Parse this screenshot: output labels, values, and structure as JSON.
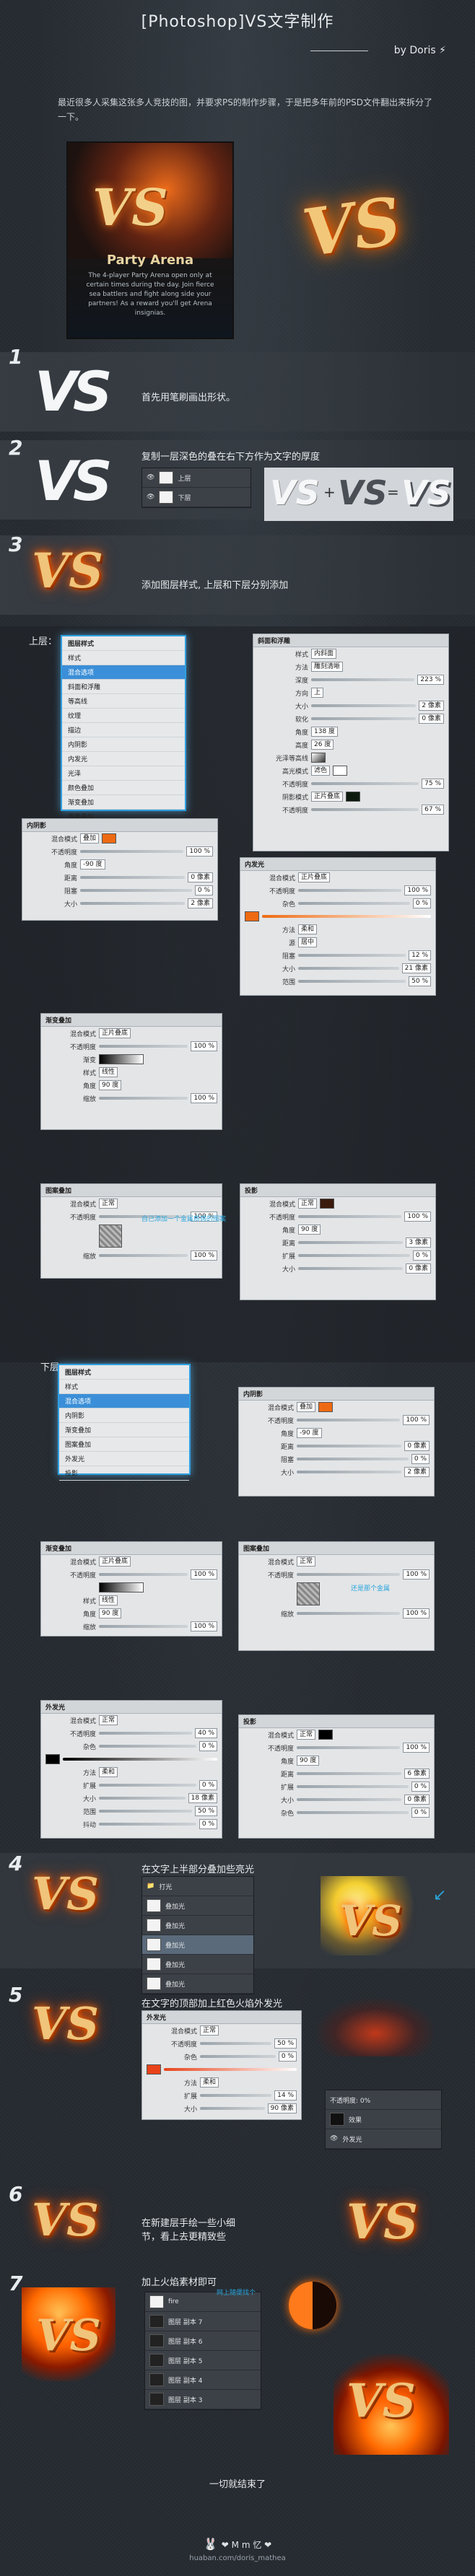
{
  "header": {
    "title": "[Photoshop]VS文字制作",
    "byline": "by Doris"
  },
  "intro": "最近很多人采集这张多人竞技的图，并要求PS的制作步骤，于是把多年前的PSD文件翻出来拆分了一下。",
  "hero": {
    "vs": "VS",
    "game_title": "Party Arena",
    "game_desc": "The 4-player Party Arena open only at certain times during the day. Join fierce sea battlers and fight along side your partners! As a reward you'll get Arena insignias."
  },
  "steps": [
    {
      "num": "1",
      "caption": "首先用笔刷画出形状。"
    },
    {
      "num": "2",
      "caption": "复制一层深色的叠在右下方作为文字的厚度",
      "layer_top": "上层",
      "layer_bottom": "下层",
      "eq": [
        "VS",
        "+",
        "VS",
        "=",
        "VS"
      ]
    },
    {
      "num": "3",
      "caption": "添加图层样式, 上层和下层分别添加"
    },
    {
      "num": "4",
      "caption": "在文字上半部分叠加些亮光"
    },
    {
      "num": "5",
      "caption": "在文字的顶部加上红色火焰外发光"
    },
    {
      "num": "6",
      "caption": "在新建层手绘一些小细节，看上去更精致些"
    },
    {
      "num": "7",
      "caption": "加上火焰素材即可",
      "note": "网上随便找个"
    }
  ],
  "upper_label": "上层：",
  "lower_label": "下层：",
  "layer_styles_upper": {
    "title": "图层样式",
    "items": [
      "样式",
      "混合选项",
      "斜面和浮雕",
      "等高线",
      "纹理",
      "描边",
      "内阴影",
      "内发光",
      "光泽",
      "颜色叠加",
      "渐变叠加",
      "图案叠加",
      "外发光",
      "投影"
    ]
  },
  "layer_styles_lower": {
    "title": "图层样式",
    "items": [
      "样式",
      "混合选项",
      "内阴影",
      "渐变叠加",
      "图案叠加",
      "外发光",
      "投影"
    ]
  },
  "bevel": {
    "title": "斜面和浮雕",
    "rows": [
      [
        "样式",
        "内斜面"
      ],
      [
        "方法",
        "雕刻清晰"
      ],
      [
        "深度",
        "223 %"
      ],
      [
        "方向",
        "上"
      ],
      [
        "大小",
        "2 像素"
      ],
      [
        "软化",
        "0 像素"
      ],
      [
        "角度",
        "138 度"
      ],
      [
        "高度",
        "26 度"
      ],
      [
        "光泽等高线",
        ""
      ],
      [
        "高光模式",
        "滤色"
      ],
      [
        "不透明度",
        "75 %"
      ],
      [
        "阴影模式",
        "正片叠底"
      ],
      [
        "不透明度",
        "67 %"
      ]
    ]
  },
  "inner_shadow": {
    "title": "内阴影",
    "rows": [
      [
        "混合模式",
        "叠加"
      ],
      [
        "不透明度",
        "100 %"
      ],
      [
        "角度",
        "-90 度"
      ],
      [
        "距离",
        "0 像素"
      ],
      [
        "阻塞",
        "0 %"
      ],
      [
        "大小",
        "2 像素"
      ]
    ],
    "color": "#ee6a12"
  },
  "inner_glow": {
    "title": "内发光",
    "rows": [
      [
        "混合模式",
        "正片叠底"
      ],
      [
        "不透明度",
        "100 %"
      ],
      [
        "杂色",
        "0 %"
      ],
      [
        "方法",
        "柔和"
      ],
      [
        "源",
        "居中"
      ],
      [
        "阻塞",
        "12 %"
      ],
      [
        "大小",
        "21 像素"
      ],
      [
        "范围",
        "50 %"
      ]
    ]
  },
  "gradient_overlay": {
    "title": "渐变叠加",
    "rows": [
      [
        "混合模式",
        "正片叠底"
      ],
      [
        "不透明度",
        "100 %"
      ],
      [
        "渐变",
        ""
      ],
      [
        "样式",
        "线性"
      ],
      [
        "角度",
        "90 度"
      ],
      [
        "缩放",
        "100 %"
      ]
    ]
  },
  "pattern_overlay": {
    "title": "图案叠加",
    "rows": [
      [
        "混合模式",
        "正常"
      ],
      [
        "不透明度",
        "100 %"
      ],
      [
        "缩放",
        "100 %"
      ]
    ],
    "note": "自己添加一个金属质感的图案"
  },
  "drop_shadow": {
    "title": "投影",
    "rows": [
      [
        "混合模式",
        "正常"
      ],
      [
        "不透明度",
        "100 %"
      ],
      [
        "角度",
        "90 度"
      ],
      [
        "距离",
        "3 像素"
      ],
      [
        "扩展",
        "0 %"
      ],
      [
        "大小",
        "0 像素"
      ]
    ],
    "color": "#3a1a0c"
  },
  "lower_inner_shadow": {
    "title": "内阴影",
    "rows": [
      [
        "混合模式",
        "叠加"
      ],
      [
        "不透明度",
        "100 %"
      ],
      [
        "角度",
        "-90 度"
      ],
      [
        "距离",
        "0 像素"
      ],
      [
        "阻塞",
        "0 %"
      ],
      [
        "大小",
        "2 像素"
      ]
    ]
  },
  "lower_gradient": {
    "title": "渐变叠加",
    "rows": [
      [
        "混合模式",
        "正片叠底"
      ],
      [
        "不透明度",
        "100 %"
      ],
      [
        "样式",
        "线性"
      ],
      [
        "角度",
        "90 度"
      ],
      [
        "缩放",
        "100 %"
      ]
    ]
  },
  "lower_pattern": {
    "title": "图案叠加",
    "rows": [
      [
        "混合模式",
        "正常"
      ],
      [
        "不透明度",
        "100 %"
      ],
      [
        "缩放",
        "100 %"
      ]
    ],
    "note": "还是那个金属"
  },
  "lower_outer_glow": {
    "title": "外发光",
    "rows": [
      [
        "混合模式",
        "正常"
      ],
      [
        "不透明度",
        "40 %"
      ],
      [
        "杂色",
        "0 %"
      ],
      [
        "方法",
        "柔和"
      ],
      [
        "扩展",
        "0 %"
      ],
      [
        "大小",
        "18 像素"
      ],
      [
        "范围",
        "50 %"
      ],
      [
        "抖动",
        "0 %"
      ]
    ]
  },
  "lower_shadow": {
    "title": "投影",
    "rows": [
      [
        "混合模式",
        "正常"
      ],
      [
        "不透明度",
        "100 %"
      ],
      [
        "角度",
        "90 度"
      ],
      [
        "距离",
        "6 像素"
      ],
      [
        "扩展",
        "0 %"
      ],
      [
        "大小",
        "0 像素"
      ],
      [
        "杂色",
        "0 %"
      ]
    ]
  },
  "step5_outer_glow": {
    "title": "外发光",
    "rows": [
      [
        "混合模式",
        "正常"
      ],
      [
        "不透明度",
        "50 %"
      ],
      [
        "杂色",
        "0 %"
      ],
      [
        "方法",
        "柔和"
      ],
      [
        "扩展",
        "14 %"
      ],
      [
        "大小",
        "90 像素"
      ]
    ]
  },
  "step4_layers": [
    "打光",
    "叠加光",
    "叠加光",
    "叠加光",
    "叠加光",
    "叠加光"
  ],
  "step5_layers": [
    "不透明度: 0%",
    "效果",
    "外发光"
  ],
  "step7_layers": [
    "fire",
    "图层 副本 7",
    "图层 副本 6",
    "图层 副本 5",
    "图层 副本 4",
    "图层 副本 3"
  ],
  "footer": {
    "done": "一切就结束了",
    "site": "huaban.com/doris_mathea",
    "sig": "❤ M m 忆 ❤"
  },
  "colors": {
    "accent": "#2aa5dc",
    "fire": "#ff6a00"
  }
}
